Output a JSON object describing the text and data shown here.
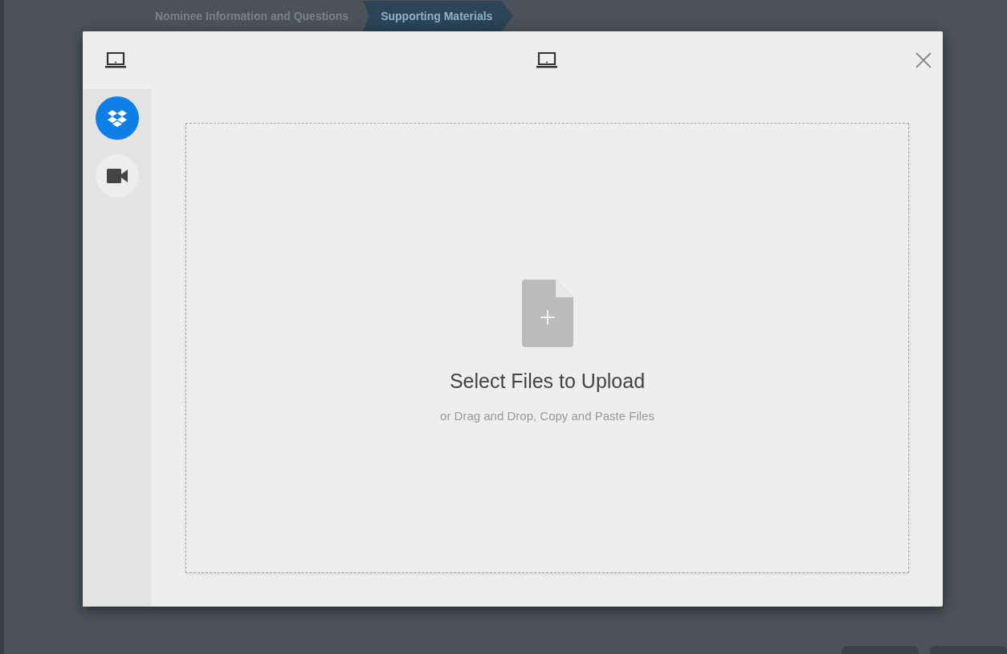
{
  "steps": [
    {
      "label": "Nominee Information and Questions",
      "selected": false
    },
    {
      "label": "Supporting Materials",
      "selected": true
    }
  ],
  "dialog": {
    "sources": [
      {
        "kind": "dropbox",
        "selected": true
      },
      {
        "kind": "video",
        "selected": false
      }
    ],
    "dropzone": {
      "title": "Select Files to Upload",
      "hint": "or Drag and Drop, Copy and Paste Files"
    }
  }
}
